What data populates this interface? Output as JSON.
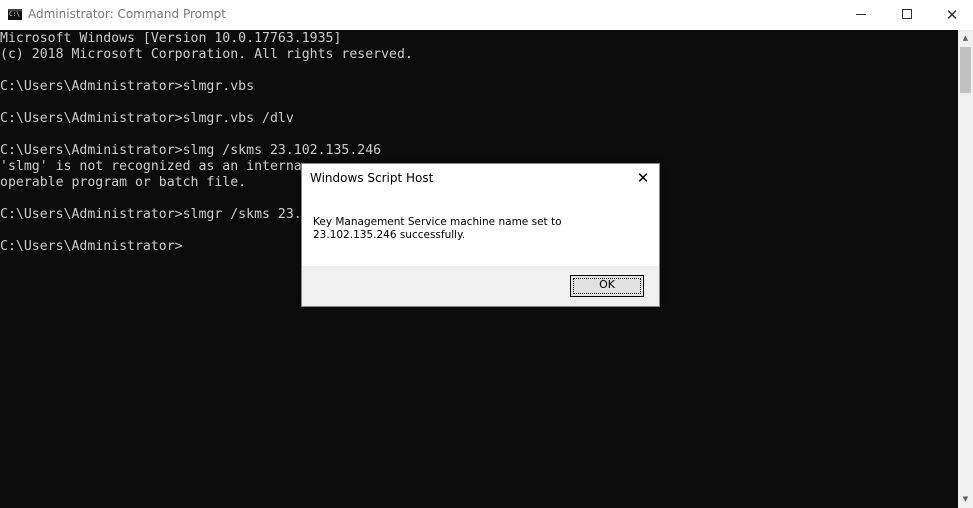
{
  "window": {
    "title": "Administrator: Command Prompt",
    "icon_text": "C:\\"
  },
  "console": {
    "lines": [
      "Microsoft Windows [Version 10.0.17763.1935]",
      "(c) 2018 Microsoft Corporation. All rights reserved.",
      "",
      "C:\\Users\\Administrator>slmgr.vbs",
      "",
      "C:\\Users\\Administrator>slmgr.vbs /dlv",
      "",
      "C:\\Users\\Administrator>slmg /skms 23.102.135.246",
      "'slmg' is not recognized as an interna",
      "operable program or batch file.",
      "",
      "C:\\Users\\Administrator>slmgr /skms 23.",
      "",
      "C:\\Users\\Administrator>"
    ]
  },
  "dialog": {
    "title": "Windows Script Host",
    "message": "Key Management Service machine name set to 23.102.135.246 successfully.",
    "ok_label": "OK"
  },
  "icons": {
    "minimize": "minimize-icon",
    "maximize": "maximize-icon",
    "close": "close-icon",
    "dialog_close": "close-icon"
  }
}
